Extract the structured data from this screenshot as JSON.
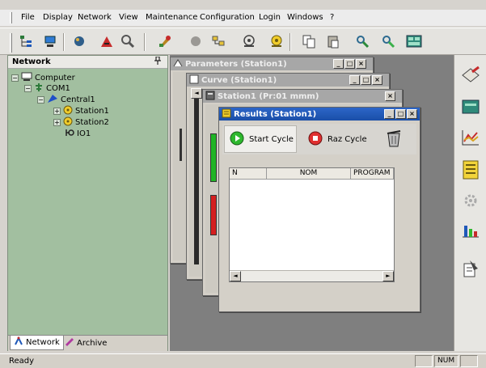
{
  "menu": [
    "File",
    "Display",
    "Network",
    "View",
    "Maintenance",
    "Configuration",
    "Login",
    "Windows",
    "?"
  ],
  "toolbar_icons": [
    "network-tree-icon",
    "station-icon",
    "mascot-icon",
    "graph-icon",
    "search-icon",
    "tool-icon",
    "circle-icon",
    "users-icon",
    "target-icon",
    "yellow-target-icon",
    "copy-icon",
    "paste-icon",
    "pan-icon",
    "pan-green-icon",
    "panel-icon"
  ],
  "panel": {
    "title": "Network",
    "pin": "p",
    "tree": [
      {
        "label": "Computer",
        "icon": "computer-icon",
        "toggle": "−"
      },
      {
        "label": "COM1",
        "icon": "com-port-icon",
        "toggle": "−"
      },
      {
        "label": "Central1",
        "icon": "central-icon",
        "toggle": "−"
      },
      {
        "label": "Station1",
        "icon": "station-node-icon",
        "toggle": "+"
      },
      {
        "label": "Station2",
        "icon": "station-node-icon",
        "toggle": "+"
      },
      {
        "label": "IO1",
        "icon": "io-icon",
        "toggle": ""
      }
    ],
    "tabs": [
      "Network",
      "Archive"
    ]
  },
  "windows": {
    "parameters": "Parameters (Station1)",
    "curve": "Curve  (Station1)",
    "station": "Station1 (Pr:01  mmm)",
    "results": "Results (Station1)"
  },
  "results": {
    "start_label": "Start Cycle",
    "raz_label": "Raz Cycle",
    "columns": [
      "N",
      "NOM",
      "PROGRAM"
    ]
  },
  "status": {
    "text": "Ready",
    "num": "NUM"
  },
  "colors": {
    "panel_bg": "#a2bfa0",
    "mdi_bg": "#7f7f7f",
    "active_title": "#1a4fa8"
  }
}
